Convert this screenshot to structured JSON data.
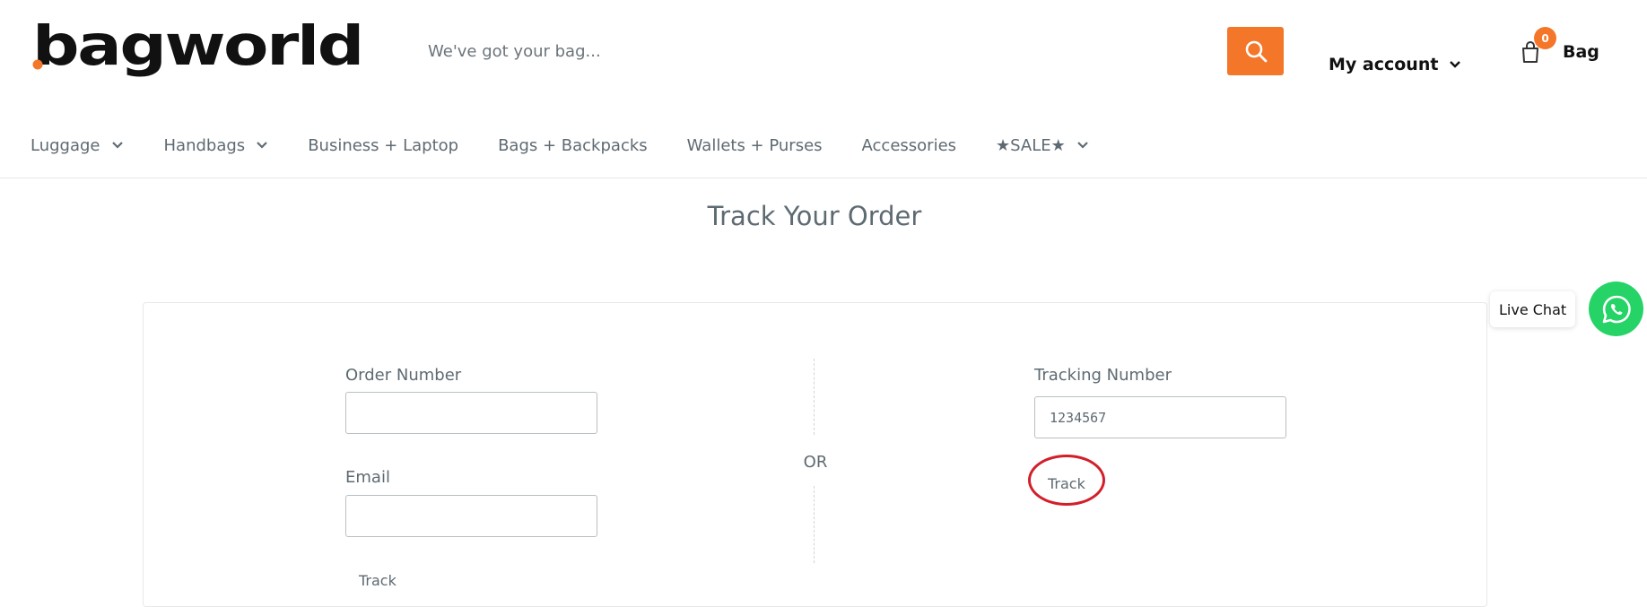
{
  "header": {
    "logo_text": "bagworld",
    "search_placeholder": "We've got your bag...",
    "account_label": "My account",
    "cart_count": "0",
    "cart_label": "Bag"
  },
  "nav": {
    "items": [
      {
        "label": "Luggage",
        "has_dropdown": true
      },
      {
        "label": "Handbags",
        "has_dropdown": true
      },
      {
        "label": "Business + Laptop",
        "has_dropdown": false
      },
      {
        "label": "Bags + Backpacks",
        "has_dropdown": false
      },
      {
        "label": "Wallets + Purses",
        "has_dropdown": false
      },
      {
        "label": "Accessories",
        "has_dropdown": false
      },
      {
        "label": "★SALE★",
        "has_dropdown": true
      }
    ]
  },
  "main": {
    "title": "Track Your Order",
    "order_form": {
      "order_number_label": "Order Number",
      "order_number_value": "",
      "email_label": "Email",
      "email_value": "",
      "submit_label": "Track"
    },
    "separator_label": "OR",
    "tracking_form": {
      "tracking_number_label": "Tracking Number",
      "tracking_number_value": "1234567",
      "submit_label": "Track"
    }
  },
  "chat": {
    "label": "Live Chat"
  },
  "colors": {
    "accent": "#f47629",
    "text": "#5e6a72",
    "whatsapp": "#25d366",
    "annotation": "#d21f2a"
  },
  "icons": [
    "search-icon",
    "chevron-down-icon",
    "shopping-bag-icon",
    "whatsapp-icon"
  ]
}
